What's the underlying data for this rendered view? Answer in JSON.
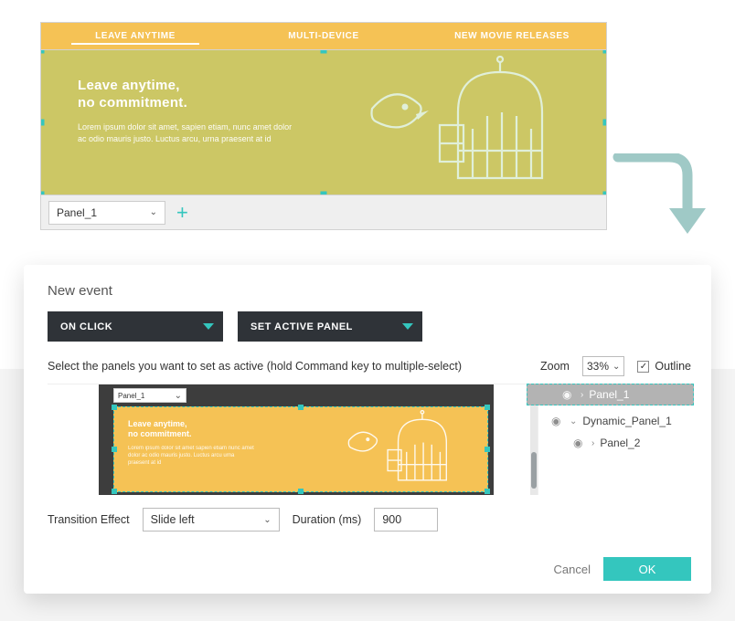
{
  "preview": {
    "tabs": [
      "LEAVE ANYTIME",
      "MULTI-DEVICE",
      "NEW MOVIE RELEASES"
    ],
    "hero_title_l1": "Leave anytime,",
    "hero_title_l2": "no commitment.",
    "hero_copy": "Lorem ipsum dolor sit amet, sapien etiam, nunc amet dolor ac odio mauris justo. Luctus arcu, urna praesent at id",
    "panel_selected": "Panel_1"
  },
  "dialog": {
    "title": "New event",
    "trigger_label": "ON CLICK",
    "action_label": "SET ACTIVE PANEL",
    "instruction": "Select the panels you want to set as active (hold Command key to multiple-select)",
    "zoom_label": "Zoom",
    "zoom_value": "33%",
    "outline_toggle_label": "Outline",
    "mini_panel_selected": "Panel_1",
    "mini_title_l1": "Leave anytime,",
    "mini_title_l2": "no commitment.",
    "mini_copy": "Lorem ipsum dolor sit amet sapien etiam nunc amet dolor ac odio mauris justo. Luctus arcu urna praesent at id",
    "outline_title": "Outline",
    "tree": {
      "root": "Dynamic_Panel_1",
      "child1": "Panel_1",
      "child2": "Panel_2"
    },
    "transition_label": "Transition Effect",
    "transition_value": "Slide left",
    "duration_label": "Duration (ms)",
    "duration_value": "900",
    "cancel_label": "Cancel",
    "ok_label": "OK"
  }
}
